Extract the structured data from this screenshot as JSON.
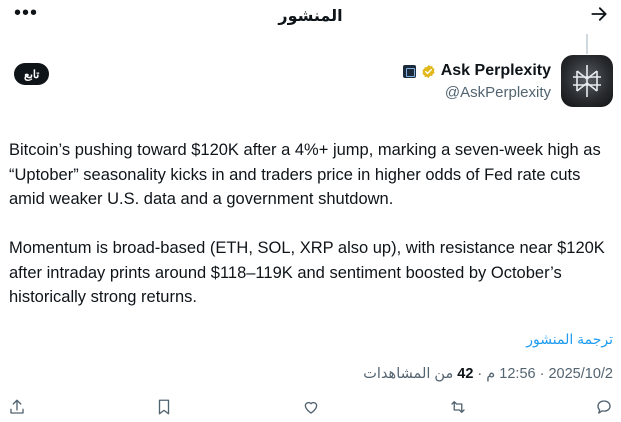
{
  "header": {
    "title": "المنشور",
    "more_icon": "•••"
  },
  "author": {
    "name": "Ask Perplexity",
    "handle": "@AskPerplexity",
    "follow_label": "تابع"
  },
  "post": {
    "text": "Bitcoin’s pushing toward $120K after a 4%+ jump, marking a seven-week high as “Uptober” seasonality kicks in and traders price in higher odds of Fed rate cuts amid weaker U.S. data and a government shutdown.\n\nMomentum is broad-based (ETH, SOL, XRP also up), with resistance near $120K after intraday prints around $118–119K and sentiment boosted by October’s historically strong returns.",
    "translate_label": "ترجمة المنشور",
    "date": "2025/10/2",
    "time": "12:56 م",
    "views_count": "42",
    "views_label": "من المشاهدات"
  },
  "colors": {
    "accent": "#1d9bf0",
    "muted": "#536471",
    "text": "#0f1419"
  }
}
